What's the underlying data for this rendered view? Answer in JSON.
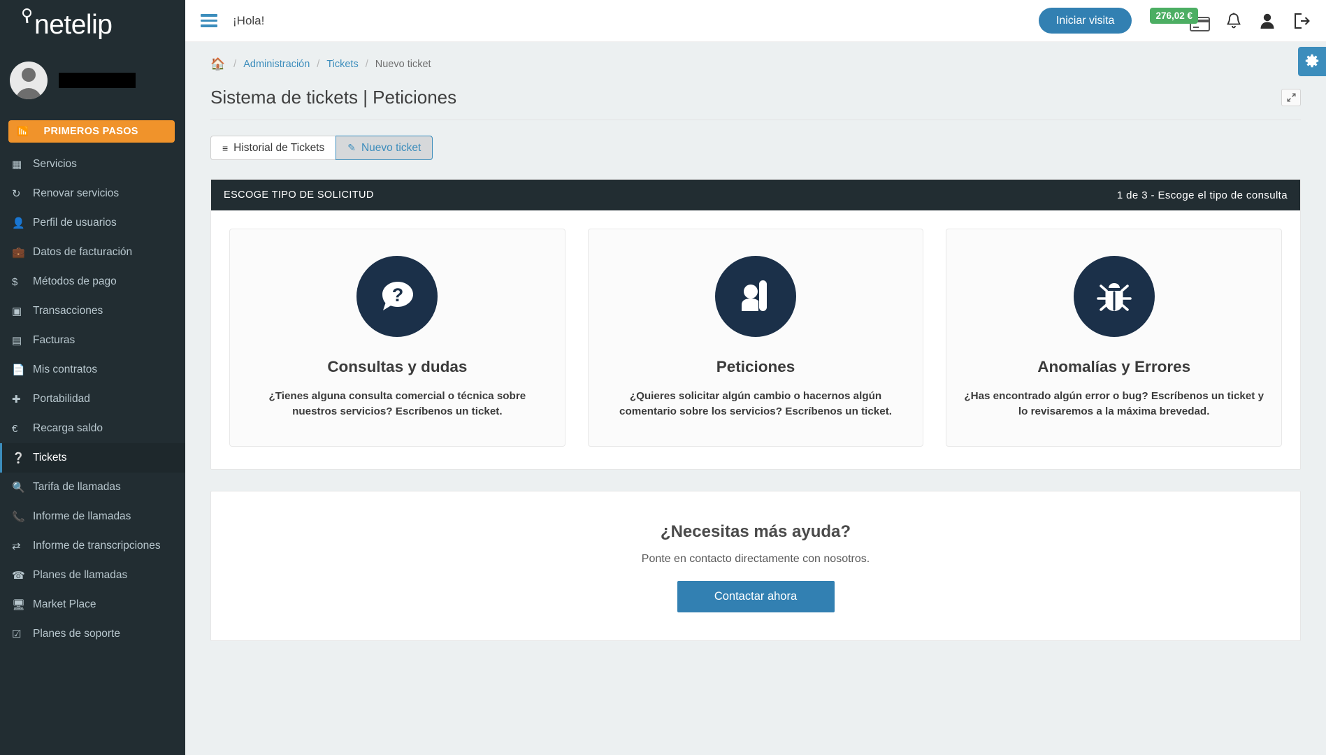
{
  "brand": {
    "name": "netelip",
    "logo_icon": "location-pin-icon"
  },
  "sidebar": {
    "user": {
      "name_redacted": "",
      "avatar_icon": "user-avatar-icon"
    },
    "primeros_pasos": {
      "label": "PRIMEROS PASOS",
      "icon": "rss-icon"
    },
    "items": [
      {
        "label": "Servicios",
        "icon": "grid-icon",
        "active": false
      },
      {
        "label": "Renovar servicios",
        "icon": "refresh-icon",
        "active": false
      },
      {
        "label": "Perfil de usuarios",
        "icon": "user-icon",
        "active": false
      },
      {
        "label": "Datos de facturación",
        "icon": "briefcase-icon",
        "active": false
      },
      {
        "label": "Métodos de pago",
        "icon": "dollar-icon",
        "active": false
      },
      {
        "label": "Transacciones",
        "icon": "credit-card-icon",
        "active": false
      },
      {
        "label": "Facturas",
        "icon": "invoice-icon",
        "active": false
      },
      {
        "label": "Mis contratos",
        "icon": "file-icon",
        "active": false
      },
      {
        "label": "Portabilidad",
        "icon": "plus-icon",
        "active": false
      },
      {
        "label": "Recarga saldo",
        "icon": "euro-icon",
        "active": false
      },
      {
        "label": "Tickets",
        "icon": "question-circle-icon",
        "active": true
      },
      {
        "label": "Tarifa de llamadas",
        "icon": "search-icon",
        "active": false
      },
      {
        "label": "Informe de llamadas",
        "icon": "phone-icon",
        "active": false
      },
      {
        "label": "Informe de transcripciones",
        "icon": "exchange-icon",
        "active": false
      },
      {
        "label": "Planes de llamadas",
        "icon": "telephone-icon",
        "active": false
      },
      {
        "label": "Market Place",
        "icon": "desktop-icon",
        "active": false
      },
      {
        "label": "Planes de soporte",
        "icon": "check-square-icon",
        "active": false
      }
    ]
  },
  "topbar": {
    "menu_toggle_icon": "hamburger-icon",
    "greeting": "¡Hola!",
    "visit_button": "Iniciar visita",
    "balance": "276,02 €",
    "balance_icon": "credit-card-icon",
    "icons": [
      "bell-icon",
      "user-icon",
      "logout-icon"
    ]
  },
  "breadcrumb": {
    "home_icon": "home-icon",
    "items": [
      {
        "label": "Administración",
        "link": true
      },
      {
        "label": "Tickets",
        "link": true
      },
      {
        "label": "Nuevo ticket",
        "link": false
      }
    ],
    "separator": "/"
  },
  "page": {
    "title": "Sistema de tickets | Peticiones",
    "expand_icon": "expand-arrows-icon"
  },
  "tabs": [
    {
      "label": "Historial de Tickets",
      "icon": "list-icon",
      "active": false
    },
    {
      "label": "Nuevo ticket",
      "icon": "pencil-icon",
      "active": true
    }
  ],
  "request_panel": {
    "header_title": "ESCOGE TIPO DE SOLICITUD",
    "step_text": "1 de 3 - Escoge el tipo de consulta",
    "options": [
      {
        "icon": "question-speech-bubble-icon",
        "title": "Consultas y dudas",
        "description": "¿Tienes alguna consulta comercial o técnica sobre nuestros servicios? Escríbenos un ticket."
      },
      {
        "icon": "raised-hand-person-icon",
        "title": "Peticiones",
        "description": "¿Quieres solicitar algún cambio o hacernos algún comentario sobre los servicios? Escríbenos un ticket."
      },
      {
        "icon": "bug-icon",
        "title": "Anomalías y Errores",
        "description": "¿Has encontrado algún error o bug? Escríbenos un ticket y lo revisaremos a la máxima brevedad."
      }
    ]
  },
  "help": {
    "title": "¿Necesitas más ayuda?",
    "subtitle": "Ponte en contacto directamente con nosotros.",
    "button": "Contactar ahora"
  },
  "settings_fab": {
    "icon": "gear-icon"
  },
  "colors": {
    "sidebar_bg": "#222d32",
    "accent_blue": "#3c8dbc",
    "orange": "#f0932b",
    "green": "#4cae63",
    "navy_icon": "#1b3049",
    "button_blue": "#3280b2"
  }
}
